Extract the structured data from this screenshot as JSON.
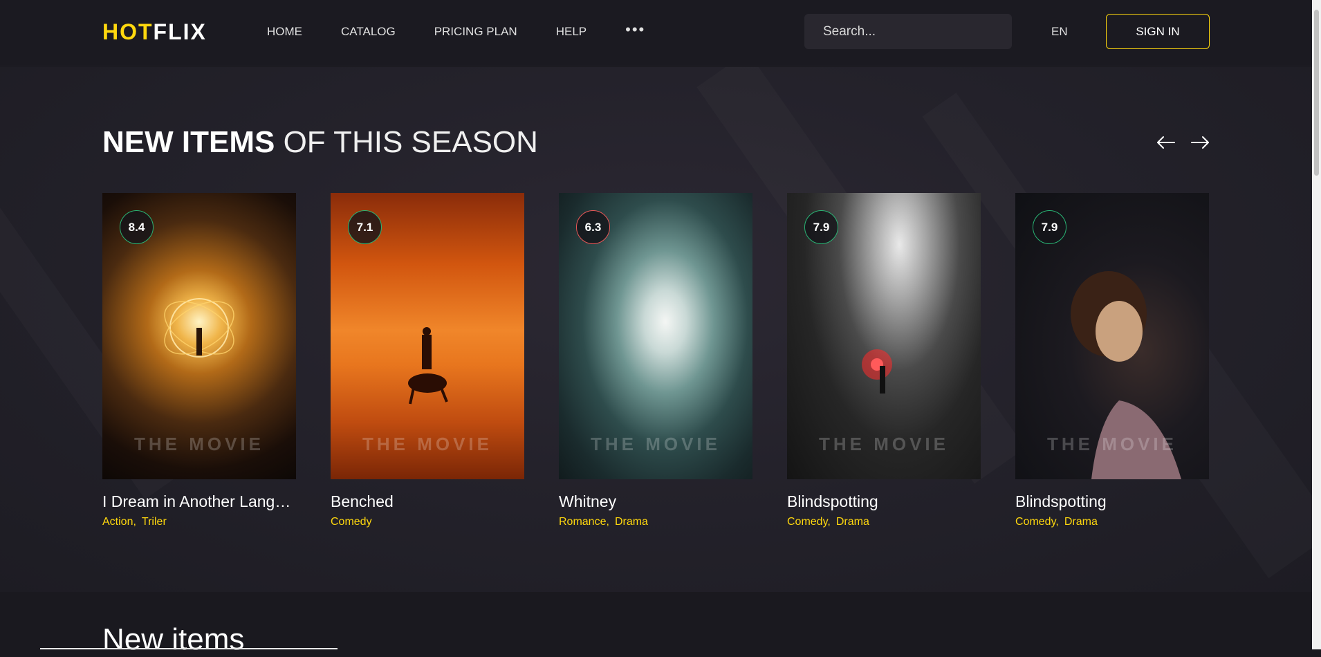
{
  "brand": {
    "part1": "HOT",
    "part2": "FLIX",
    "accent": "#ffd80e"
  },
  "nav": {
    "items": [
      "HOME",
      "CATALOG",
      "PRICING PLAN",
      "HELP"
    ],
    "more": "•••"
  },
  "search": {
    "placeholder": "Search...",
    "icon": "search-icon"
  },
  "lang": "EN",
  "signin": "SIGN IN",
  "section": {
    "title_bold": "NEW ITEMS",
    "title_light": "OF THIS SEASON",
    "prev_icon": "arrow-left-icon",
    "next_icon": "arrow-right-icon"
  },
  "cards": [
    {
      "rating": "8.4",
      "rating_color": "#29b474",
      "watermark": "THE MOVIE",
      "title": "I Dream in Another Language",
      "genres": [
        "Action",
        "Triler"
      ]
    },
    {
      "rating": "7.1",
      "rating_color": "#29b474",
      "watermark": "THE MOVIE",
      "title": "Benched",
      "genres": [
        "Comedy"
      ]
    },
    {
      "rating": "6.3",
      "rating_color": "#eb5757",
      "watermark": "THE MOVIE",
      "title": "Whitney",
      "genres": [
        "Romance",
        "Drama"
      ]
    },
    {
      "rating": "7.9",
      "rating_color": "#29b474",
      "watermark": "THE MOVIE",
      "title": "Blindspotting",
      "genres": [
        "Comedy",
        "Drama"
      ]
    },
    {
      "rating": "7.9",
      "rating_color": "#29b474",
      "watermark": "THE MOVIE",
      "title": "Blindspotting",
      "genres": [
        "Comedy",
        "Drama"
      ]
    }
  ],
  "bottom": {
    "title": "New items"
  }
}
